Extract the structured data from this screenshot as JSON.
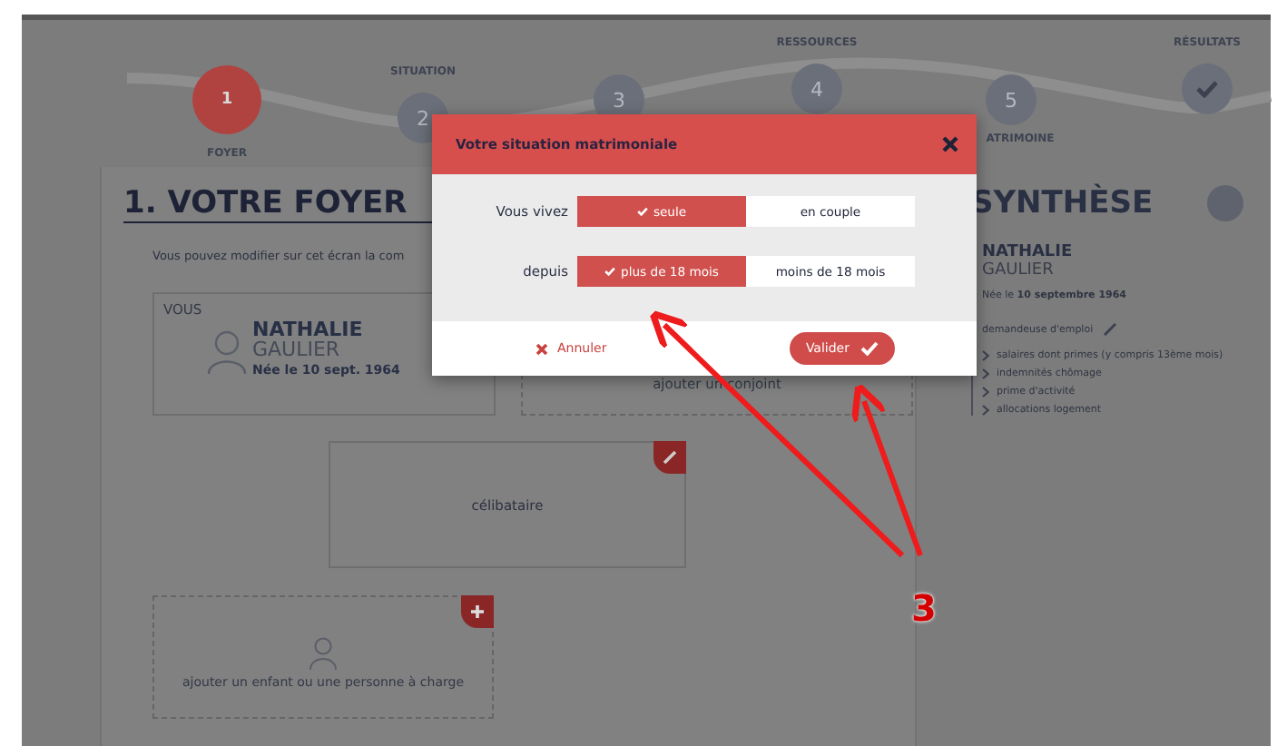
{
  "steps": [
    {
      "kind": "number",
      "number": "1",
      "label": "FOYER",
      "selected": true
    },
    {
      "kind": "number",
      "number": "2",
      "label": "SITUATION",
      "selected": false
    },
    {
      "kind": "number",
      "number": "3",
      "selected": false
    },
    {
      "kind": "number",
      "number": "4",
      "label": "RESSOURCES",
      "selected": false
    },
    {
      "kind": "number",
      "number": "5",
      "label": "ATRIMOINE",
      "selected": false
    },
    {
      "kind": "check",
      "label": "RÉSULTATS",
      "selected": false
    }
  ],
  "foyer": {
    "title": "1. VOTRE FOYER",
    "intro": "Vous pouvez modifier sur cet écran la com",
    "you_card": {
      "heading": "VOUS",
      "first_name": "NATHALIE",
      "last_name": "GAULIER",
      "birth": "Née le 10 sept. 1964"
    },
    "spouse_card": {
      "text": "ajouter un conjoint"
    },
    "status_card": {
      "text": "célibataire"
    },
    "child_card": {
      "text": "ajouter un enfant ou une personne à charge"
    }
  },
  "synthesis": {
    "title": "SYNTHÈSE",
    "first_name": "NATHALIE",
    "last_name": "GAULIER",
    "birth": "Née le **10 septembre 1964**",
    "status": "demandeuse d'emploi",
    "items": [
      "salaires dont primes (y compris 13ème mois)",
      "indemnités chômage",
      "prime d'activité",
      "allocations logement"
    ]
  },
  "modal": {
    "title": "Votre situation matrimoniale",
    "rows": [
      {
        "label": "Vous vivez",
        "options": [
          {
            "label": "seule",
            "selected": true
          },
          {
            "label": "en couple",
            "selected": false
          }
        ]
      },
      {
        "label": "depuis",
        "options": [
          {
            "label": "plus de 18 mois",
            "selected": true
          },
          {
            "label": "moins de 18 mois",
            "selected": false
          }
        ]
      }
    ],
    "cancel": "Annuler",
    "confirm": "Valider"
  },
  "annotation": {
    "number": "3"
  }
}
